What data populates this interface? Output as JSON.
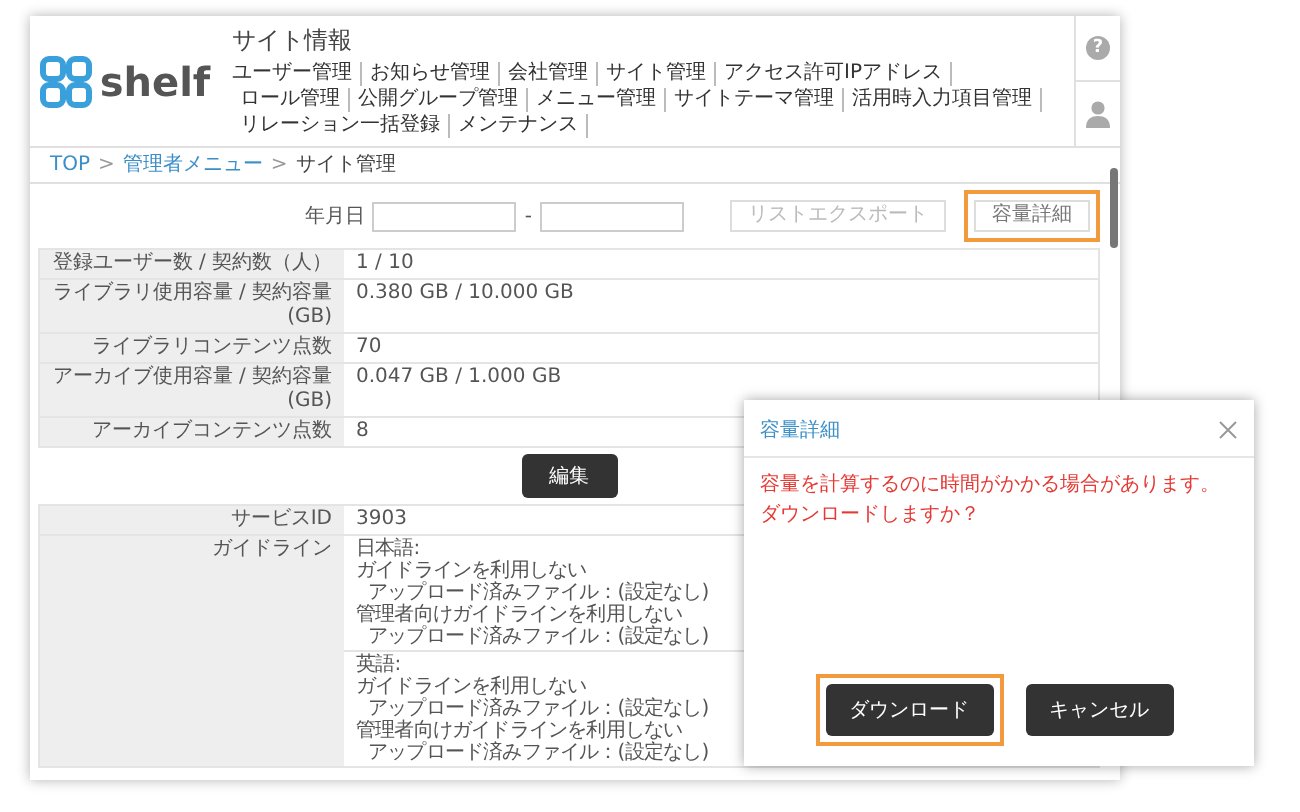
{
  "header": {
    "logo_text": "shelf",
    "title": "サイト情報",
    "nav": [
      "ユーザー管理",
      "お知らせ管理",
      "会社管理",
      "サイト管理",
      "アクセス許可IPアドレス",
      "ロール管理",
      "公開グループ管理",
      "メニュー管理",
      "サイトテーマ管理",
      "活用時入力項目管理",
      "リレーション一括登録",
      "メンテナンス"
    ],
    "help_glyph": "?"
  },
  "breadcrumb": [
    {
      "label": "TOP",
      "link": true
    },
    {
      "label": "管理者メニュー",
      "link": true
    },
    {
      "label": "サイト管理",
      "link": false
    }
  ],
  "breadcrumb_separator": ">",
  "toolbar": {
    "date_label": "年月日",
    "range_separator": "-",
    "buttons": [
      {
        "label": "リストエクスポート",
        "disabled": true,
        "highlighted": false
      },
      {
        "label": "容量詳細",
        "disabled": false,
        "highlighted": true
      }
    ]
  },
  "usage_table": [
    {
      "label": "登録ユーザー数 / 契約数（人）",
      "value": "1 / 10"
    },
    {
      "label": "ライブラリ使用容量 / 契約容量(GB)",
      "value": "0.380 GB / 10.000 GB"
    },
    {
      "label": "ライブラリコンテンツ点数",
      "value": "70"
    },
    {
      "label": "アーカイブ使用容量 / 契約容量(GB)",
      "value": "0.047 GB / 1.000 GB"
    },
    {
      "label": "アーカイブコンテンツ点数",
      "value": "8"
    }
  ],
  "edit_button": "編集",
  "service_id": {
    "label": "サービスID",
    "value": "3903"
  },
  "guideline": {
    "label": "ガイドライン",
    "blocks": [
      {
        "language": "日本語:",
        "items": [
          {
            "text": "ガイドラインを利用しない",
            "children": [
              {
                "text": "アップロード済みファイル：(設定なし)"
              }
            ]
          },
          {
            "text": "管理者向けガイドラインを利用しない",
            "children": [
              {
                "text": "アップロード済みファイル：(設定なし)"
              }
            ]
          }
        ]
      },
      {
        "language": "英語:",
        "items": [
          {
            "text": "ガイドラインを利用しない",
            "children": [
              {
                "text": "アップロード済みファイル：(設定なし)"
              }
            ]
          },
          {
            "text": "管理者向けガイドラインを利用しない",
            "children": [
              {
                "text": "アップロード済みファイル：(設定なし)"
              }
            ]
          }
        ]
      }
    ]
  },
  "dialog": {
    "title": "容量詳細",
    "message_lines": [
      "容量を計算するのに時間がかかる場合があります。",
      "ダウンロードしますか？"
    ],
    "buttons": [
      {
        "label": "ダウンロード",
        "highlighted": true
      },
      {
        "label": "キャンセル",
        "highlighted": false
      }
    ]
  }
}
